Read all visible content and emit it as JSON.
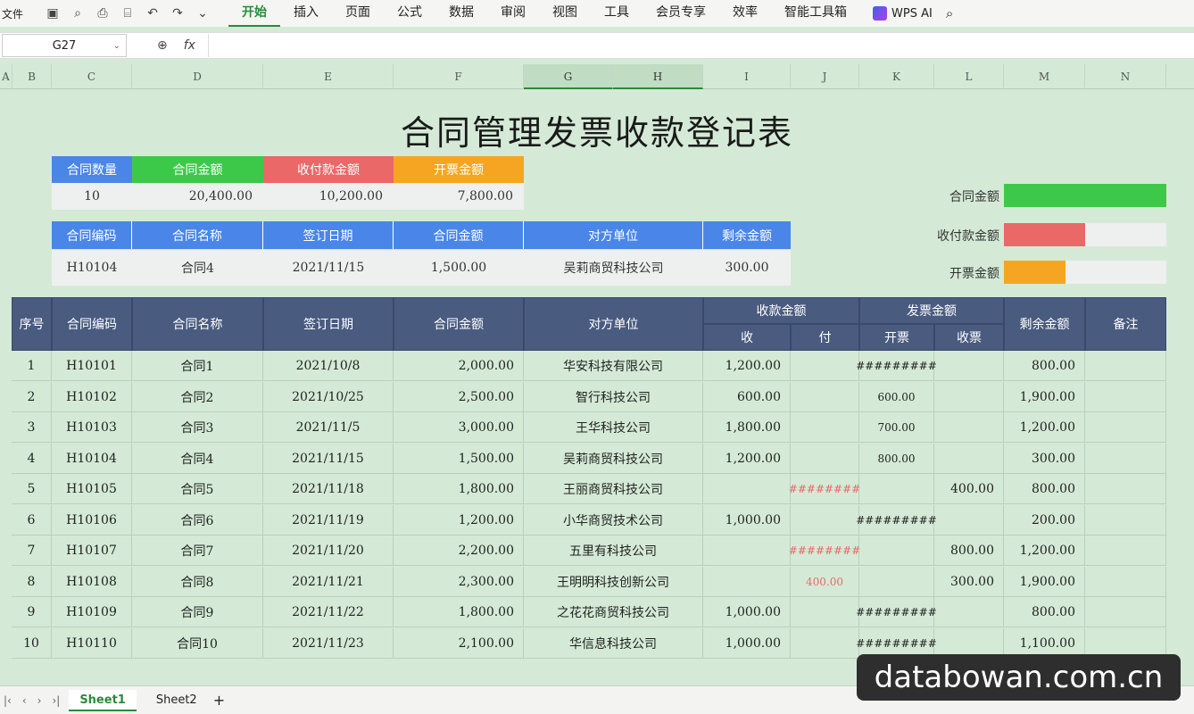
{
  "menubar": {
    "file": "文件",
    "tabs": [
      "开始",
      "插入",
      "页面",
      "公式",
      "数据",
      "审阅",
      "视图",
      "工具",
      "会员专享",
      "效率",
      "智能工具箱"
    ],
    "active_tab": "开始",
    "wps_ai": "WPS AI"
  },
  "formula_bar": {
    "namebox": "G27",
    "fx": "fx"
  },
  "columns": [
    "A",
    "B",
    "C",
    "D",
    "E",
    "F",
    "G",
    "H",
    "I",
    "J",
    "K",
    "L",
    "M",
    "N"
  ],
  "title": "合同管理发票收款登记表",
  "summary": {
    "headers": [
      "合同数量",
      "合同金额",
      "收付款金额",
      "开票金额"
    ],
    "values": [
      "10",
      "20,400.00",
      "10,200.00",
      "7,800.00"
    ]
  },
  "lookup": {
    "headers": [
      "合同编码",
      "合同名称",
      "签订日期",
      "合同金额",
      "对方单位",
      "剩余金额"
    ],
    "values": [
      "H10104",
      "合同4",
      "2021/11/15",
      "1,500.00",
      "吴莉商贸科技公司",
      "300.00"
    ]
  },
  "legend": [
    {
      "label": "合同金额",
      "fraction": 1.0,
      "color": "#3cc94a"
    },
    {
      "label": "收付款金额",
      "fraction": 0.5,
      "color": "#ea6868"
    },
    {
      "label": "开票金额",
      "fraction": 0.38,
      "color": "#f6a522"
    }
  ],
  "table": {
    "headers": {
      "seq": "序号",
      "code": "合同编码",
      "name": "合同名称",
      "date": "签订日期",
      "amount": "合同金额",
      "party": "对方单位",
      "receive_group": "收款金额",
      "receive": "收",
      "pay": "付",
      "invoice_group": "发票金额",
      "invoice_open": "开票",
      "invoice_recv": "收票",
      "remain": "剩余金额",
      "note": "备注"
    },
    "rows": [
      {
        "seq": "1",
        "code": "H10101",
        "name": "合同1",
        "date": "2021/10/8",
        "amount": "2,000.00",
        "party": "华安科技有限公司",
        "receive": "1,200.00",
        "pay": "",
        "open": "#########",
        "recv": "",
        "remain": "800.00"
      },
      {
        "seq": "2",
        "code": "H10102",
        "name": "合同2",
        "date": "2021/10/25",
        "amount": "2,500.00",
        "party": "智行科技公司",
        "receive": "600.00",
        "pay": "",
        "open": "600.00",
        "recv": "",
        "remain": "1,900.00"
      },
      {
        "seq": "3",
        "code": "H10103",
        "name": "合同3",
        "date": "2021/11/5",
        "amount": "3,000.00",
        "party": "王华科技公司",
        "receive": "1,800.00",
        "pay": "",
        "open": "700.00",
        "recv": "",
        "remain": "1,200.00"
      },
      {
        "seq": "4",
        "code": "H10104",
        "name": "合同4",
        "date": "2021/11/15",
        "amount": "1,500.00",
        "party": "吴莉商贸科技公司",
        "receive": "1,200.00",
        "pay": "",
        "open": "800.00",
        "recv": "",
        "remain": "300.00"
      },
      {
        "seq": "5",
        "code": "H10105",
        "name": "合同5",
        "date": "2021/11/18",
        "amount": "1,800.00",
        "party": "王丽商贸科技公司",
        "receive": "",
        "pay": "########",
        "open": "",
        "recv": "400.00",
        "remain": "800.00"
      },
      {
        "seq": "6",
        "code": "H10106",
        "name": "合同6",
        "date": "2021/11/19",
        "amount": "1,200.00",
        "party": "小华商贸技术公司",
        "receive": "1,000.00",
        "pay": "",
        "open": "#########",
        "recv": "",
        "remain": "200.00"
      },
      {
        "seq": "7",
        "code": "H10107",
        "name": "合同7",
        "date": "2021/11/20",
        "amount": "2,200.00",
        "party": "五里有科技公司",
        "receive": "",
        "pay": "########",
        "open": "",
        "recv": "800.00",
        "remain": "1,200.00"
      },
      {
        "seq": "8",
        "code": "H10108",
        "name": "合同8",
        "date": "2021/11/21",
        "amount": "2,300.00",
        "party": "王明明科技创新公司",
        "receive": "",
        "pay": "400.00",
        "open": "",
        "recv": "300.00",
        "remain": "1,900.00"
      },
      {
        "seq": "9",
        "code": "H10109",
        "name": "合同9",
        "date": "2021/11/22",
        "amount": "1,800.00",
        "party": "之花花商贸科技公司",
        "receive": "1,000.00",
        "pay": "",
        "open": "#########",
        "recv": "",
        "remain": "800.00"
      },
      {
        "seq": "10",
        "code": "H10110",
        "name": "合同10",
        "date": "2021/11/23",
        "amount": "2,100.00",
        "party": "华信息科技公司",
        "receive": "1,000.00",
        "pay": "",
        "open": "#########",
        "recv": "",
        "remain": "1,100.00"
      }
    ]
  },
  "sheets": [
    "Sheet1",
    "Sheet2"
  ],
  "active_sheet": "Sheet1",
  "watermark": "databowan.com.cn"
}
